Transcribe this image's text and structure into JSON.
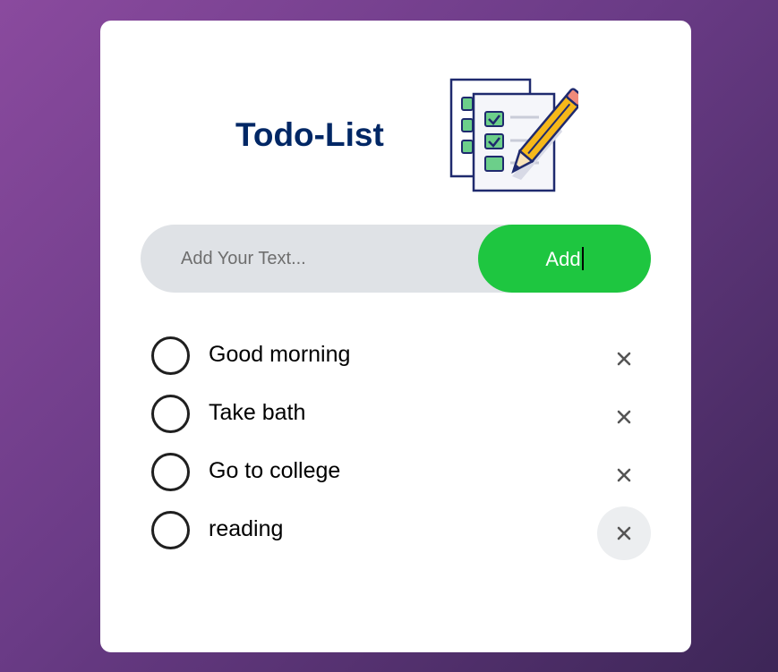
{
  "app": {
    "title": "Todo-List"
  },
  "input": {
    "placeholder": "Add Your Text...",
    "value": ""
  },
  "add_button": {
    "label": "Add"
  },
  "todos": [
    {
      "text": "Good morning",
      "checked": false
    },
    {
      "text": "Take bath",
      "checked": false
    },
    {
      "text": "Go to college",
      "checked": false
    },
    {
      "text": "reading",
      "checked": false
    }
  ],
  "icons": {
    "logo": "todo-checklist-pencil-icon",
    "check": "circle-icon",
    "delete": "close-icon"
  },
  "colors": {
    "title": "#002765",
    "add_button": "#1ec640",
    "input_bg": "#dfe2e6",
    "card_bg": "#ffffff",
    "background_start": "#8a4a9e",
    "background_end": "#3d2657"
  }
}
